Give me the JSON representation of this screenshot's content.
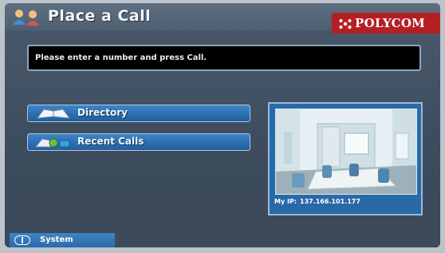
{
  "header": {
    "title": "Place a Call",
    "title_icon": "people-icon",
    "brand": "POLYCOM",
    "brand_icon": "polycom-logo-icon",
    "brand_color": "#b51f24"
  },
  "prompt": {
    "text": "Please enter a number and press Call."
  },
  "menu": {
    "items": [
      {
        "label": "Directory",
        "icon": "directory-book-icon"
      },
      {
        "label": "Recent Calls",
        "icon": "recent-calls-icon"
      }
    ]
  },
  "preview": {
    "ip_label": "My IP:",
    "ip_value": "137.166.101.177"
  },
  "footer": {
    "system_label": "System",
    "system_icon": "info-icon"
  },
  "colors": {
    "background": "#3e4d5e",
    "button": "#2a6cb0",
    "prompt_bg": "#000000"
  }
}
